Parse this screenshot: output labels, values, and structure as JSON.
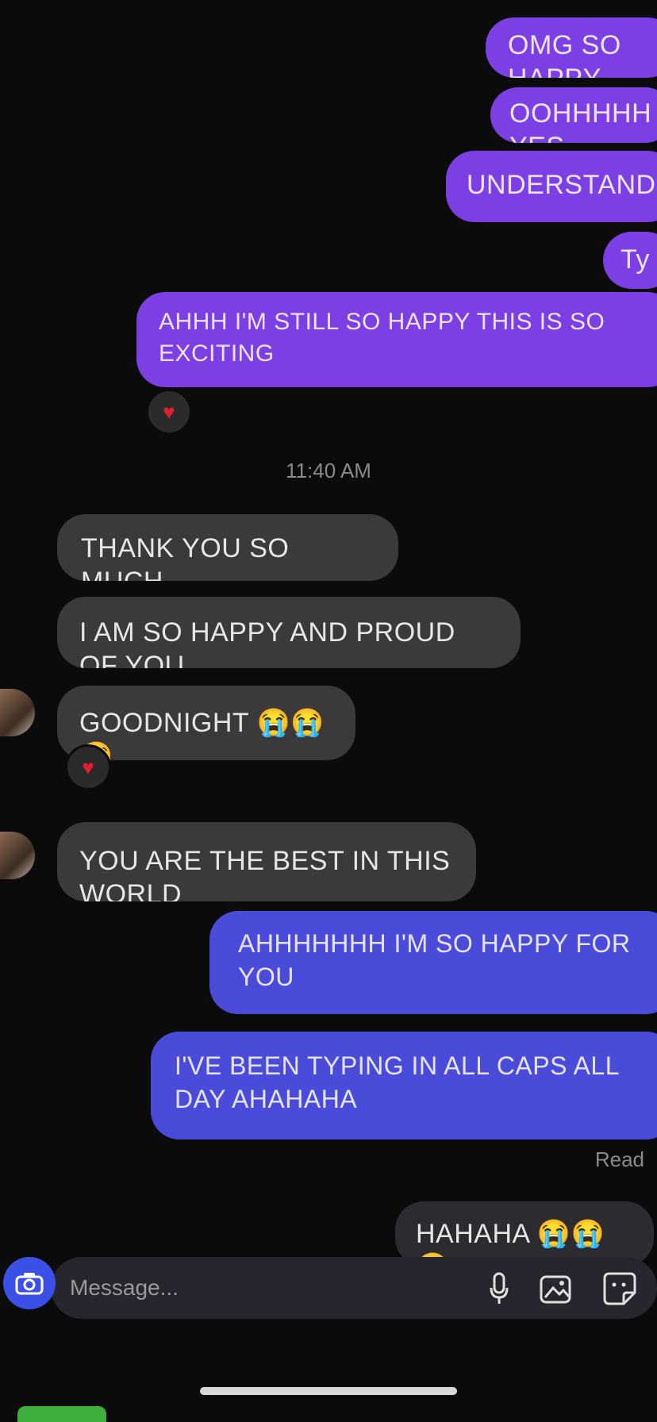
{
  "colors": {
    "background": "#0b0b0b",
    "sent_purple": "#7b3fe4",
    "sent_blue": "#4b4bd9",
    "received": "#3a3a3a",
    "reaction_heart": "#e0202e"
  },
  "thread": {
    "sent_messages_top": [
      {
        "text": "OMG SO HAPPY"
      },
      {
        "text": "OOHHHHH YES"
      },
      {
        "text": "UNDERSTANDING"
      },
      {
        "text": "Ty"
      },
      {
        "text": "AHHH I'M STILL SO HAPPY THIS IS SO EXCITING",
        "reaction_icon": "heart-reaction-icon"
      }
    ],
    "timestamp_1": "11:40 AM",
    "received_messages": [
      {
        "text": "THANK YOU SO MUCH"
      },
      {
        "text": "I AM SO HAPPY AND PROUD OF YOU"
      },
      {
        "text": "GOODNIGHT 😭😭😭",
        "reaction_icon": "heart-reaction-icon"
      },
      {
        "text": "YOU ARE THE BEST IN THIS WORLD"
      }
    ],
    "sent_messages_bottom": [
      {
        "text": "AHHHHHHH I'M SO HAPPY FOR YOU"
      },
      {
        "text": "I'VE BEEN TYPING IN ALL CAPS ALL DAY AHAHAHA"
      }
    ],
    "read_receipt": "Read",
    "last_sent": {
      "text": "HAHAHA 😭😭😭"
    }
  },
  "composer": {
    "placeholder": "Message...",
    "camera_icon": "camera-icon",
    "mic_icon": "microphone-icon",
    "gallery_icon": "gallery-icon",
    "sticker_icon": "sticker-icon"
  }
}
